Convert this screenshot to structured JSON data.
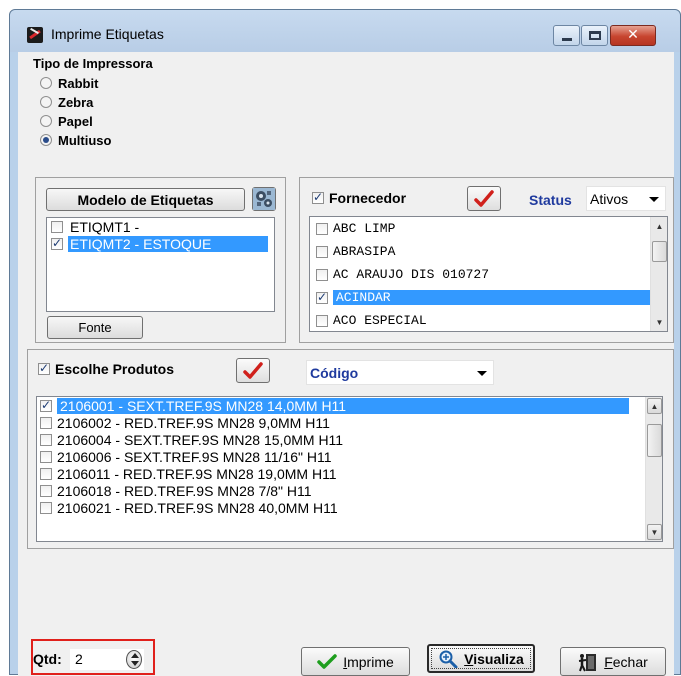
{
  "window": {
    "title": "Imprime Etiquetas",
    "close_glyph": "✕"
  },
  "printer_type": {
    "title": "Tipo de Impressora",
    "options": [
      {
        "label": "Rabbit",
        "checked": false
      },
      {
        "label": "Zebra",
        "checked": false
      },
      {
        "label": "Papel",
        "checked": false
      },
      {
        "label": "Multiuso",
        "checked": true
      }
    ]
  },
  "model": {
    "button_label": "Modelo de Etiquetas",
    "items": [
      {
        "label": "ETIQMT1 -",
        "checked": false,
        "selected": false
      },
      {
        "label": "ETIQMT2 - ESTOQUE",
        "checked": true,
        "selected": true
      }
    ],
    "font_button_label": "Fonte"
  },
  "supplier": {
    "checkbox_label": "Fornecedor",
    "status_label": "Status",
    "status_value": "Ativos",
    "items": [
      {
        "label": "ABC LIMP",
        "checked": false,
        "selected": false
      },
      {
        "label": "ABRASIPA",
        "checked": false,
        "selected": false
      },
      {
        "label": "AC ARAUJO DIS 010727",
        "checked": false,
        "selected": false
      },
      {
        "label": "ACINDAR",
        "checked": true,
        "selected": true
      },
      {
        "label": "ACO ESPECIAL",
        "checked": false,
        "selected": false
      }
    ]
  },
  "products": {
    "checkbox_label": "Escolhe Produtos",
    "sort_value": "Código",
    "items": [
      {
        "label": "2106001 - SEXT.TREF.9S MN28 14,0MM H11",
        "checked": true,
        "selected": true
      },
      {
        "label": "2106002 - RED.TREF.9S MN28 9,0MM H11",
        "checked": false,
        "selected": false
      },
      {
        "label": "2106004 - SEXT.TREF.9S MN28 15,0MM H11",
        "checked": false,
        "selected": false
      },
      {
        "label": "2106006 - SEXT.TREF.9S MN28 11/16\" H11",
        "checked": false,
        "selected": false
      },
      {
        "label": "2106011 - RED.TREF.9S MN28 19,0MM H11",
        "checked": false,
        "selected": false
      },
      {
        "label": "2106018 - RED.TREF.9S MN28 7/8\" H11",
        "checked": false,
        "selected": false
      },
      {
        "label": "2106021 - RED.TREF.9S MN28 40,0MM H11",
        "checked": false,
        "selected": false
      }
    ]
  },
  "footer": {
    "qty_label": "Qtd:",
    "qty_value": "2",
    "print_label": "Imprime",
    "preview_label": "Visualiza",
    "close_label": "Fechar"
  },
  "colors": {
    "selection": "#3399ff",
    "highlight_border": "#e0201b",
    "blue_label": "#1f3a9e",
    "window_frame": "#b9d1ea"
  }
}
